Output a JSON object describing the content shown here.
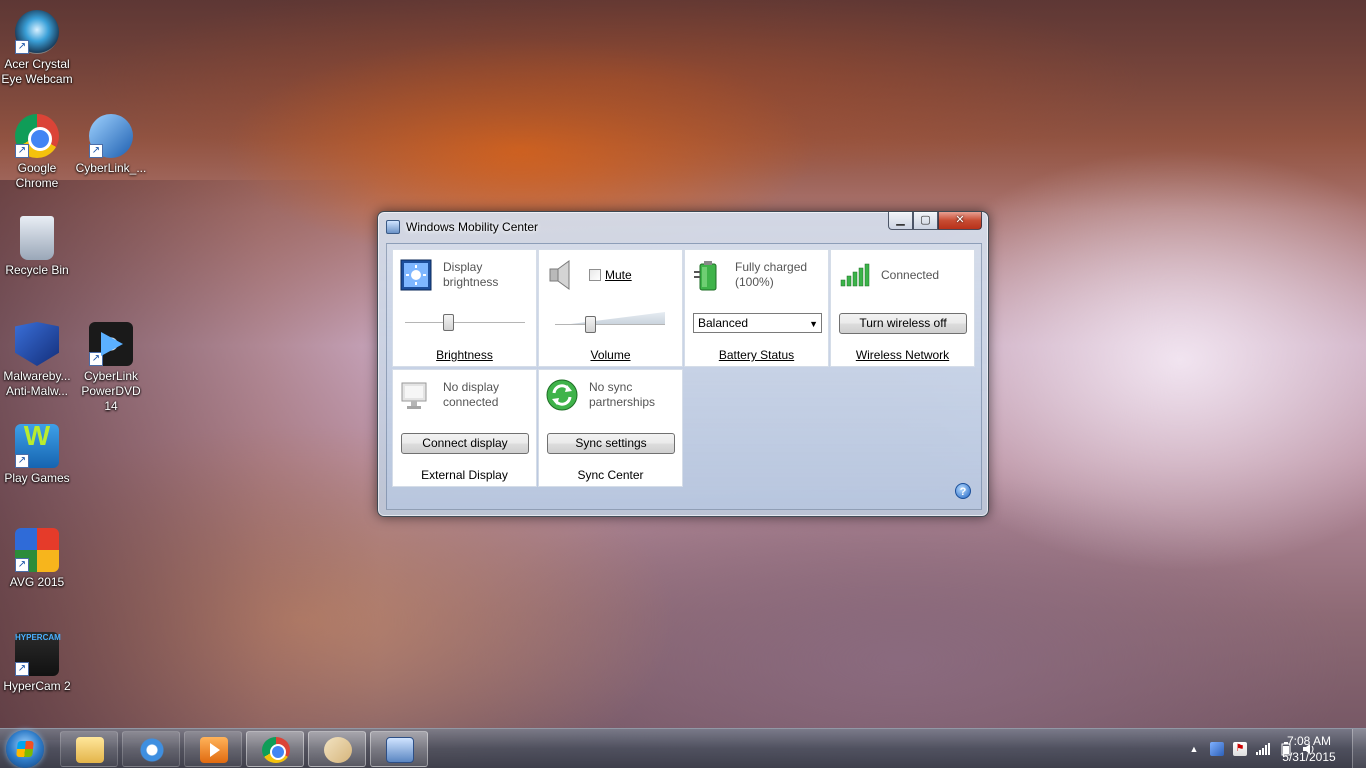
{
  "desktop": {
    "icons": [
      {
        "label": "Acer Crystal Eye Webcam",
        "icon": "webcam-icon"
      },
      {
        "label": "Google Chrome",
        "icon": "chrome-icon"
      },
      {
        "label": "CyberLink_...",
        "icon": "cyberlink-icon"
      },
      {
        "label": "Recycle Bin",
        "icon": "recycle-bin-icon"
      },
      {
        "label": "Malwareby... Anti-Malw...",
        "icon": "malwarebytes-icon"
      },
      {
        "label": "CyberLink PowerDVD 14",
        "icon": "powerdvd-icon"
      },
      {
        "label": "Play Games",
        "icon": "play-games-icon"
      },
      {
        "label": "AVG 2015",
        "icon": "avg-icon"
      },
      {
        "label": "HyperCam 2",
        "icon": "hypercam-icon"
      }
    ]
  },
  "window": {
    "title": "Windows Mobility Center",
    "controls": {
      "minimize": "▁",
      "maximize": "▢",
      "close": "✕"
    },
    "tiles": {
      "brightness": {
        "status": "Display brightness",
        "label": "Brightness",
        "level": 0.35
      },
      "volume": {
        "mute_label": "Mute",
        "muted": false,
        "label": "Volume",
        "level": 0.3
      },
      "battery": {
        "status": "Fully charged (100%)",
        "plan": "Balanced",
        "label": "Battery Status"
      },
      "wireless": {
        "status": "Connected",
        "button": "Turn wireless off",
        "label": "Wireless Network"
      },
      "external": {
        "status": "No display connected",
        "button": "Connect display",
        "label": "External Display"
      },
      "sync": {
        "status": "No sync partnerships",
        "button": "Sync settings",
        "label": "Sync Center"
      }
    },
    "help": "?"
  },
  "taskbar": {
    "apps": [
      {
        "name": "explorer",
        "icon": "folder-icon"
      },
      {
        "name": "internet-explorer",
        "icon": "ie-icon"
      },
      {
        "name": "media-player",
        "icon": "media-player-icon"
      },
      {
        "name": "chrome",
        "icon": "chrome-icon"
      },
      {
        "name": "paint",
        "icon": "paint-icon"
      },
      {
        "name": "mobility-center",
        "icon": "mobility-center-icon",
        "active": true
      }
    ],
    "tray": {
      "show_hidden": "▲"
    },
    "clock": {
      "time": "7:08 AM",
      "date": "5/31/2015"
    }
  }
}
